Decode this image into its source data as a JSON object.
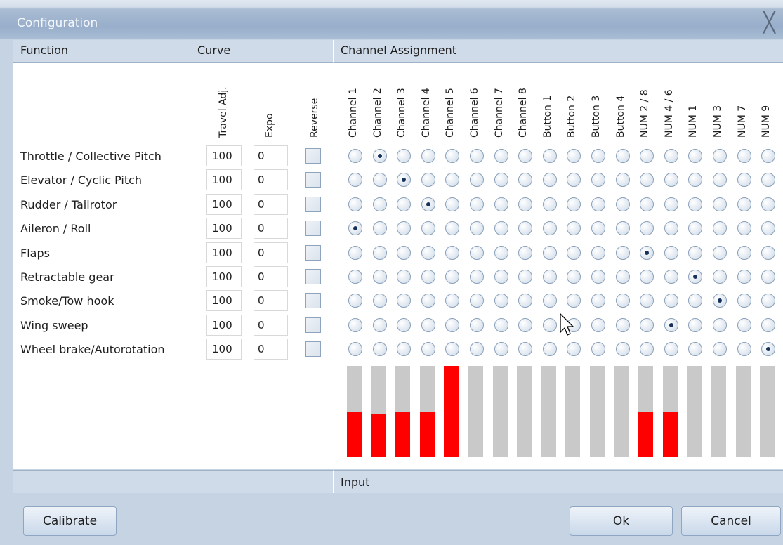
{
  "window": {
    "title": "Configuration"
  },
  "headers": {
    "function": "Function",
    "curve": "Curve",
    "channel_assignment": "Channel Assignment",
    "input": "Input"
  },
  "columns": {
    "travel_adj": "Travel Adj.",
    "expo": "Expo",
    "reverse": "Reverse"
  },
  "channels": [
    "Channel 1",
    "Channel 2",
    "Channel 3",
    "Channel 4",
    "Channel 5",
    "Channel 6",
    "Channel 7",
    "Channel 8",
    "Button 1",
    "Button 2",
    "Button 3",
    "Button 4",
    "NUM 2 / 8",
    "NUM 4 / 6",
    "NUM 1",
    "NUM 3",
    "NUM 7",
    "NUM 9"
  ],
  "functions": [
    {
      "name": "Throttle / Collective Pitch",
      "travel": "100",
      "expo": "0",
      "reverse": false,
      "selected": 1
    },
    {
      "name": "Elevator / Cyclic Pitch",
      "travel": "100",
      "expo": "0",
      "reverse": false,
      "selected": 2
    },
    {
      "name": "Rudder / Tailrotor",
      "travel": "100",
      "expo": "0",
      "reverse": false,
      "selected": 3
    },
    {
      "name": "Aileron / Roll",
      "travel": "100",
      "expo": "0",
      "reverse": false,
      "selected": 0
    },
    {
      "name": "Flaps",
      "travel": "100",
      "expo": "0",
      "reverse": false,
      "selected": 12
    },
    {
      "name": "Retractable gear",
      "travel": "100",
      "expo": "0",
      "reverse": false,
      "selected": 14
    },
    {
      "name": "Smoke/Tow hook",
      "travel": "100",
      "expo": "0",
      "reverse": false,
      "selected": 15
    },
    {
      "name": "Wing sweep",
      "travel": "100",
      "expo": "0",
      "reverse": false,
      "selected": 13
    },
    {
      "name": "Wheel brake/Autorotation",
      "travel": "100",
      "expo": "0",
      "reverse": false,
      "selected": 17
    }
  ],
  "input_levels": [
    0.5,
    0.48,
    0.5,
    0.5,
    1.0,
    0,
    0,
    0,
    0,
    0,
    0,
    0,
    0.5,
    0.5,
    0,
    0,
    0,
    0
  ],
  "buttons": {
    "calibrate": "Calibrate",
    "ok": "Ok",
    "cancel": "Cancel"
  },
  "colors": {
    "input_bar": "#ff0000",
    "bar_background": "#c9c9c9",
    "chrome": "#c5d3e3"
  }
}
